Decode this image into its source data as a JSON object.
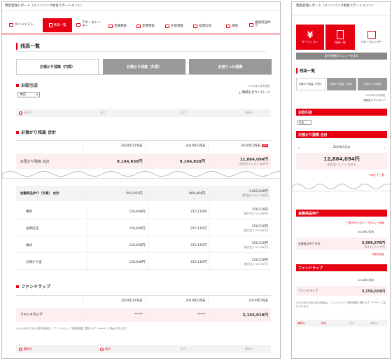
{
  "header": {
    "title": "資産管理レポート（メインバンク総合ステートメント）"
  },
  "nav": {
    "items": [
      "ダイジェスト",
      "残高一覧",
      "マネーカレンダー",
      "普通預金",
      "定期預金",
      "外貨預金",
      "投資信託",
      "保険",
      "金融商品仲介"
    ]
  },
  "page_title": "残高一覧",
  "tabs": [
    "お預かり残高（円貨）",
    "お預かり残高（外貨）",
    "お借り入れ残高"
  ],
  "branch": {
    "title": "お取引店",
    "select": "本店",
    "date": "2019年2月末現在",
    "download": "明細をダウンロード"
  },
  "pager": {
    "first": "最終月",
    "prev": "前月",
    "next": "翌月",
    "last": "最新月"
  },
  "total": {
    "title": "お預かり残高 合計",
    "cols": [
      "2018年12月末",
      "2019年1月末",
      "2019年2月末"
    ],
    "new": "NEW",
    "label": "お預かり残高 合計",
    "v1": "9,146,830円",
    "v2": "9,146,830円",
    "v3": "12,864,094円",
    "v3sub": "(前月比＋3,717,264円)"
  },
  "broker": {
    "label": "金融商品仲介（外貨） 合計",
    "v1": "602,592円",
    "v2": "860,464円",
    "v3": "1,002,040円",
    "v3sub": "(前月比＋141,576円)",
    "rows": [
      {
        "label": "債券",
        "v1": "150,648円",
        "v2": "215,116円",
        "v3": "250,510円",
        "v3sub": "(前月比＋35,394円)"
      },
      {
        "label": "投資信託",
        "v1": "150,648円",
        "v2": "215,116円",
        "v3": "250,510円",
        "v3sub": "(前月比＋35,394円)"
      },
      {
        "label": "株式",
        "v1": "150,648円",
        "v2": "215,116円",
        "v3": "250,510円",
        "v3sub": "(前月比＋35,394円)"
      },
      {
        "label": "お預かり金",
        "v1": "150,648円",
        "v2": "215,116円",
        "v3": "250,510円",
        "v3sub": "(前月比＋35,394円)"
      }
    ]
  },
  "fundwrap": {
    "title": "ファンドラップ",
    "cols": [
      "2018年12月末",
      "2019年1月末",
      "2019年2月末"
    ],
    "label": "ファンドラップ",
    "v1": "*****",
    "v2": "*****",
    "v3": "3,156,019円",
    "note": "※2019年1月末以前の残高は、ファンドラップ契約期間に関わらず「*****」と表示されます。"
  },
  "mobile": {
    "title": "資産管理レポート（メインバンク総合ステートメント）",
    "nav": [
      "ダイジェスト",
      "残高一覧",
      "マネーカレンダー"
    ],
    "menu_button": "取引明細のメニューを見る",
    "page_title": "残高一覧",
    "tabs": [
      "お預かり残高（円貨）",
      "お預かり残高（外貨）",
      "お借り入れ残高"
    ],
    "date": "2019年2月末現在",
    "download": "明細をダウンロード",
    "branch": "お取引店",
    "select": "本店",
    "total_title": "お預かり残高 合計",
    "month": "2019年1月末",
    "total_value": "12,864,094円",
    "total_sub": "(前月比＋3,717,264円)",
    "monthly": "つみたて一覧",
    "broker_title": "金融商品仲介",
    "broker_link": "三菱UFJモルガン・スタンレー証券",
    "broker_month": "2019年2月末",
    "broker_label": "金融商品仲介 合計",
    "broker_value": "3,506,676円",
    "broker_sub": "(前月比＋107,679円)",
    "detail": "内訳を見る",
    "fw_title": "ファンドラップ",
    "fw_month": "2019年2月末",
    "fw_label": "ファンドラップ",
    "fw_value": "3,156,019円",
    "fw_note": "※2019年1月末以前の残高は、ファンドラップ契約期間に関わらず「*****」と表示されます。",
    "prev": "前月",
    "first": "最終月",
    "next": "翌月",
    "last": "最新月"
  }
}
